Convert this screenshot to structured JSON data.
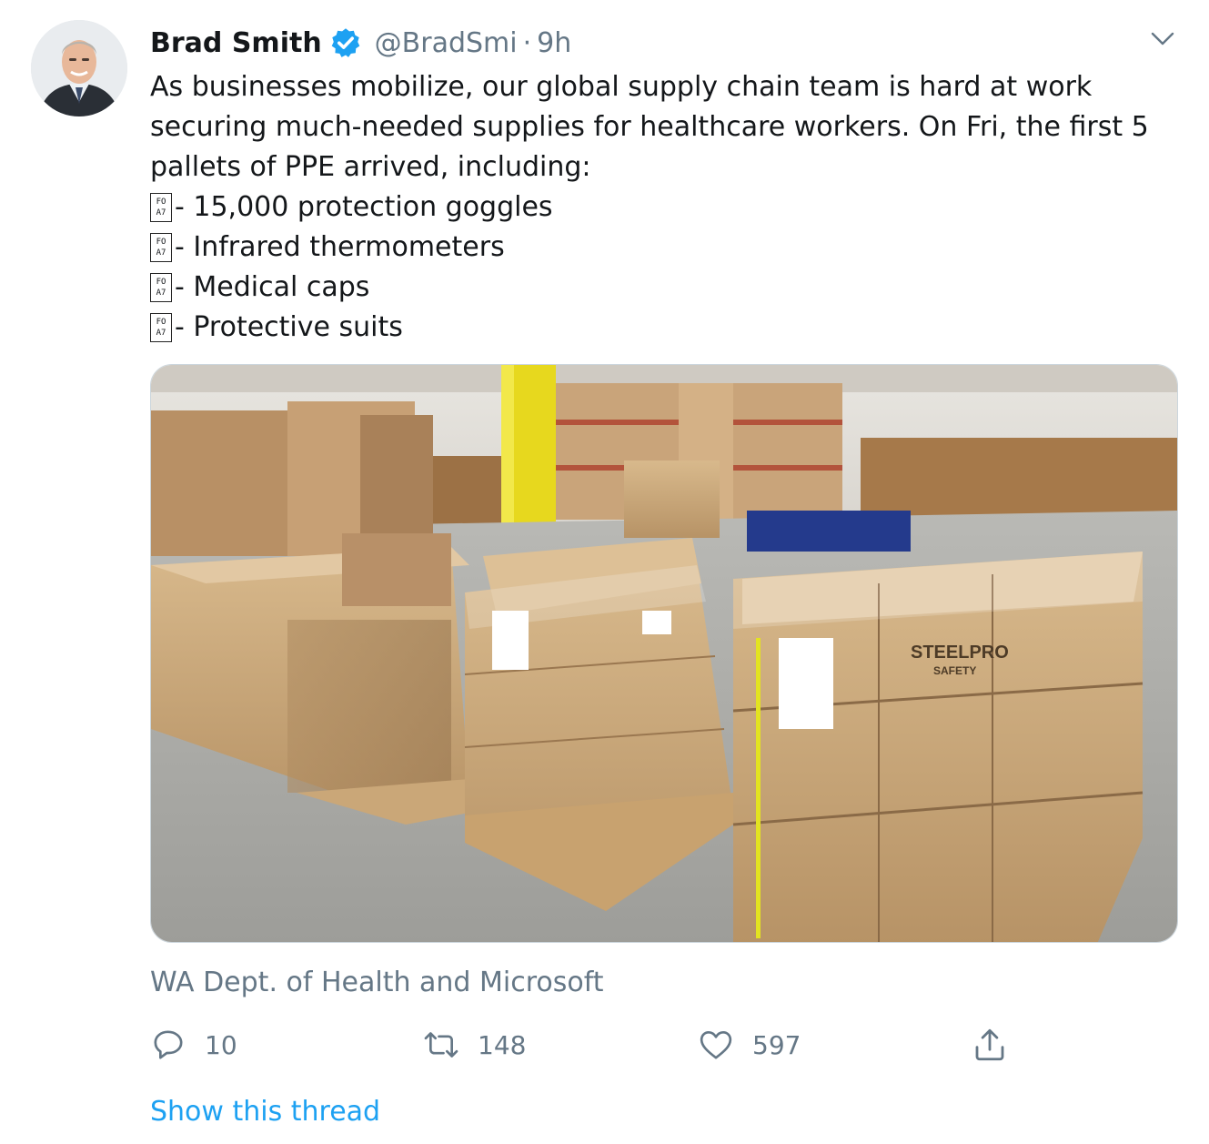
{
  "tweet": {
    "author_name": "Brad Smith",
    "handle": "@BradSmi",
    "separator": "·",
    "time": "9h",
    "verified": true,
    "avatar_icon": "profile-photo",
    "menu_icon": "chevron-down-icon",
    "text_intro": "As businesses mobilize, our global supply chain team is hard at work securing much-needed supplies for healthcare workers. On Fri, the first 5 pallets of PPE arrived, including:",
    "list_glyph": "FO\nA7",
    "list_items": [
      "- 15,000 protection goggles",
      "- Infrared thermometers",
      "- Medical caps",
      "- Protective suits"
    ],
    "photo": {
      "description_icon": "warehouse-pallets-photo",
      "box_labels": [
        "STEELPRO",
        "SAFETY"
      ]
    },
    "photo_caption": "WA Dept. of Health and Microsoft",
    "actions": {
      "reply": {
        "icon": "reply-icon",
        "count": "10"
      },
      "retweet": {
        "icon": "retweet-icon",
        "count": "148"
      },
      "like": {
        "icon": "heart-icon",
        "count": "597"
      },
      "share": {
        "icon": "share-icon"
      }
    },
    "show_thread": "Show this thread"
  },
  "colors": {
    "text": "#14171a",
    "secondary": "#657786",
    "link": "#1da1f2",
    "verified": "#1da1f2"
  }
}
